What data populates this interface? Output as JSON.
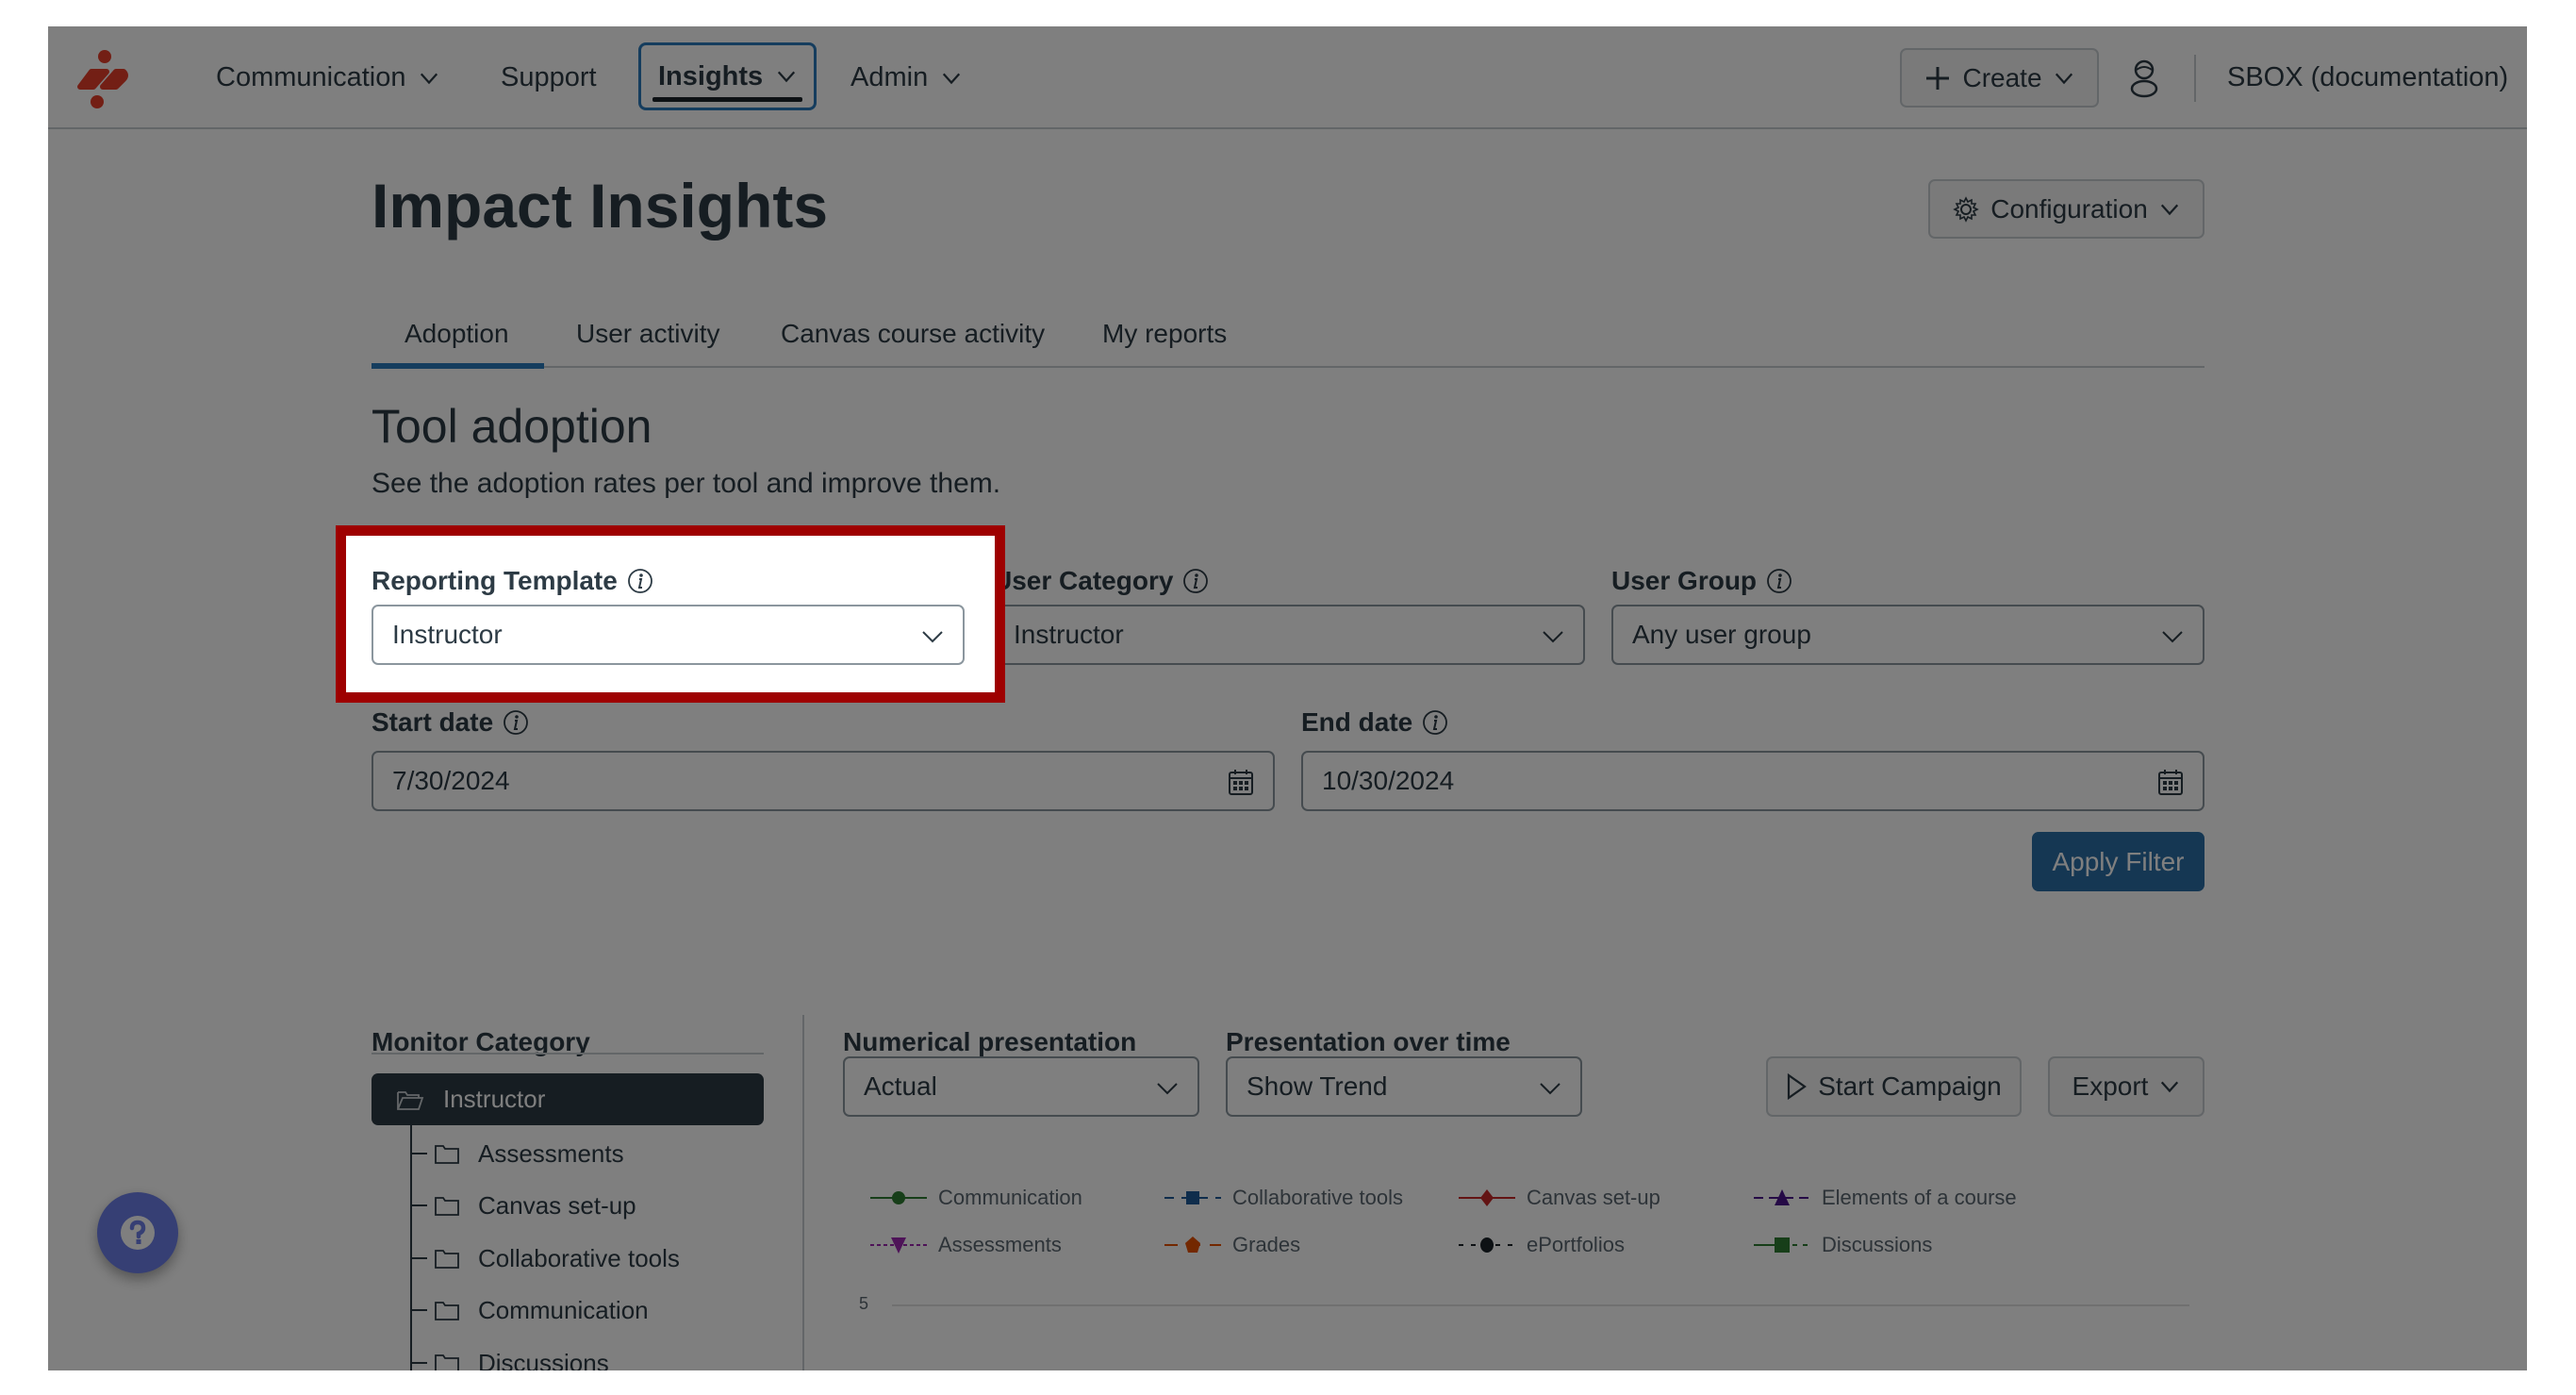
{
  "header": {
    "logo": "canvas-logo",
    "nav": [
      {
        "label": "Communication",
        "has_menu": true
      },
      {
        "label": "Support",
        "has_menu": false
      },
      {
        "label": "Insights",
        "has_menu": true,
        "active": true
      },
      {
        "label": "Admin",
        "has_menu": true
      }
    ],
    "create_label": "Create",
    "account_label": "SBOX (documentation)"
  },
  "page": {
    "title": "Impact Insights",
    "configuration_label": "Configuration",
    "tabs": [
      {
        "label": "Adoption",
        "active": true
      },
      {
        "label": "User activity"
      },
      {
        "label": "Canvas course activity"
      },
      {
        "label": "My reports"
      }
    ]
  },
  "section": {
    "title": "Tool adoption",
    "subtitle": "See the adoption rates per tool and improve them."
  },
  "filters": {
    "reporting_template": {
      "label": "Reporting Template",
      "value": "Instructor"
    },
    "user_category": {
      "label": "User Category",
      "value": "Instructor"
    },
    "user_group": {
      "label": "User Group",
      "value": "Any user group"
    },
    "start_date": {
      "label": "Start date",
      "value": "7/30/2024"
    },
    "end_date": {
      "label": "End date",
      "value": "10/30/2024"
    },
    "apply_label": "Apply Filter"
  },
  "monitor": {
    "label": "Monitor Category",
    "selected": "Instructor",
    "items": [
      "Assessments",
      "Canvas set-up",
      "Collaborative tools",
      "Communication",
      "Discussions"
    ]
  },
  "controls": {
    "numerical_label": "Numerical presentation",
    "numerical_value": "Actual",
    "time_label": "Presentation over time",
    "time_value": "Show Trend",
    "start_campaign_label": "Start Campaign",
    "export_label": "Export"
  },
  "chart": {
    "legend": [
      {
        "label": "Communication",
        "color": "#2e7d32",
        "marker": "circle",
        "dash": "solid"
      },
      {
        "label": "Collaborative tools",
        "color": "#1f5a99",
        "marker": "square",
        "dash": "dashed"
      },
      {
        "label": "Canvas set-up",
        "color": "#c62828",
        "marker": "diamond",
        "dash": "solid"
      },
      {
        "label": "Elements of a course",
        "color": "#4a148c",
        "marker": "triangle-up",
        "dash": "dashed"
      },
      {
        "label": "Assessments",
        "color": "#9c27b0",
        "marker": "triangle-down",
        "dash": "dotted"
      },
      {
        "label": "Grades",
        "color": "#e65100",
        "marker": "pentagon",
        "dash": "solid"
      },
      {
        "label": "ePortfolios",
        "color": "#1b2329",
        "marker": "circle",
        "dash": "dashed"
      },
      {
        "label": "Discussions",
        "color": "#2e7d32",
        "marker": "square",
        "dash": "dashed"
      }
    ],
    "y_ticks": [
      "5"
    ]
  },
  "colors": {
    "accent": "#2b7abc",
    "highlight": "#9e0000",
    "primary_button": "#2b6ea6",
    "logo": "#e63e2b",
    "help_button": "#6c7fe8"
  }
}
